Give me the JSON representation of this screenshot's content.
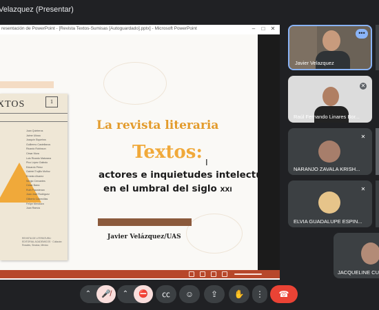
{
  "meeting": {
    "presenter_title": "Velazquez (Presentar)"
  },
  "presentation_window": {
    "title": "resentación de PowerPoint - [Revista Textos-Sumisas [Autoguardado].pptx] - Microsoft PowerPoint",
    "controls": {
      "minimize": "–",
      "maximize": "□",
      "close": "✕"
    }
  },
  "slide": {
    "magazine": {
      "title": "XTOS",
      "issue_number": "1",
      "contributors": [
        "Juan Quinteros",
        "Jaime Uliosa",
        "Joaquín Siqueiros",
        "Guillermo Castellanos",
        "Ricardo Robinson",
        "César Mora",
        "Luis Ricardo Maturana",
        "Pico López Galindo",
        "Eduardo Pérez",
        "Gabriel Trujillo Muñoz",
        "Ernesto Alvarez",
        "Sergio Cervantes",
        "Cesar Barra",
        "Ruth Fraustenan",
        "Juan José Rodríguez",
        "Gilberto Cobrecillas",
        "Felipe Mendoza",
        "Juan Ramos"
      ],
      "imprint": "REVISTA DE LITERATURA · EDITORIAL ACADEMICOS · Culiacán Rosales, Sinaloa, México"
    },
    "title_line1": "La revista literaria",
    "title_line2": "Textos:",
    "subtitle_line1": "actores e inquietudes intelectuales",
    "subtitle_line2": "en el umbral del siglo",
    "subtitle_century": "XXI",
    "author": "Javier Velázquez/UAS"
  },
  "participants": [
    {
      "name": "Javier Velazquez",
      "muted": false,
      "speaking": true
    },
    {
      "name": "Raúl Fernando Linares Bor...",
      "muted": true
    },
    {
      "name": "NARANJO ZAVALA KRISH...",
      "muted": true
    },
    {
      "name": "ELVIA GUADALUPE ESPIN...",
      "muted": true
    },
    {
      "name": "JACQUELINE CU",
      "muted": false
    }
  ],
  "controls": {
    "mic_state": "off",
    "camera_state": "off",
    "icons": [
      "chevron-up",
      "mic-off",
      "chevron-up",
      "camera-off",
      "captions",
      "emoji",
      "present",
      "raise-hand",
      "more",
      "end-call"
    ]
  },
  "colors": {
    "background": "#202124",
    "accent_orange": "#f0a93a",
    "end_call": "#ea4335",
    "powerpoint_bar": "#b7472a"
  }
}
